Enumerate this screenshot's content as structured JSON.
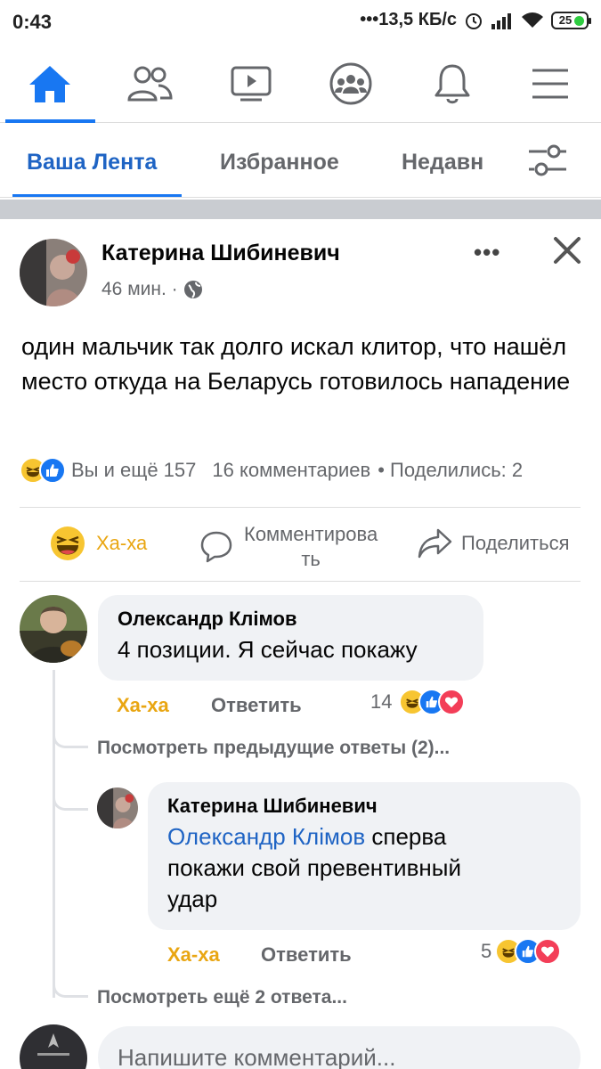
{
  "status_bar": {
    "time": "0:43",
    "speed": "•••13,5 КБ/с",
    "battery": "25"
  },
  "nav": {
    "items": [
      "home-icon",
      "friends-icon",
      "watch-icon",
      "groups-icon",
      "notifications-icon",
      "menu-icon"
    ],
    "accent": "#1877f2"
  },
  "feed_tabs": [
    "Ваша Лента",
    "Избранное",
    "Недавн"
  ],
  "post": {
    "author": "Катерина Шибиневич",
    "time": "46 мин. ·",
    "text": "один мальчик так долго искал клитор, что нашёл место откуда на Беларусь готовилось нападение",
    "reactions": "Вы и ещё 157",
    "comments": "16 комментариев",
    "shares": "• Поделились: 2",
    "actions": {
      "haha": "Ха-ха",
      "comment_line1": "Комментирова",
      "comment_line2": "ть",
      "share": "Поделиться"
    }
  },
  "comments": [
    {
      "name": "Олександр Клімов",
      "text": "4 позиции. Я сейчас покажу",
      "haha": "Ха-ха",
      "reply": "Ответить",
      "count": "14"
    },
    {
      "name": "Катерина Шибиневич",
      "mention": "Олександр Клімов",
      "text_l1": "сперва",
      "text_l2": "покажи свой превентивный",
      "text_l3": "удар",
      "haha": "Ха-ха",
      "reply": "Ответить",
      "count": "5"
    }
  ],
  "view_prev": "Посмотреть предыдущие ответы (2)...",
  "view_more": "Посмотреть ещё 2 ответа...",
  "composer_placeholder": "Напишите комментарий..."
}
